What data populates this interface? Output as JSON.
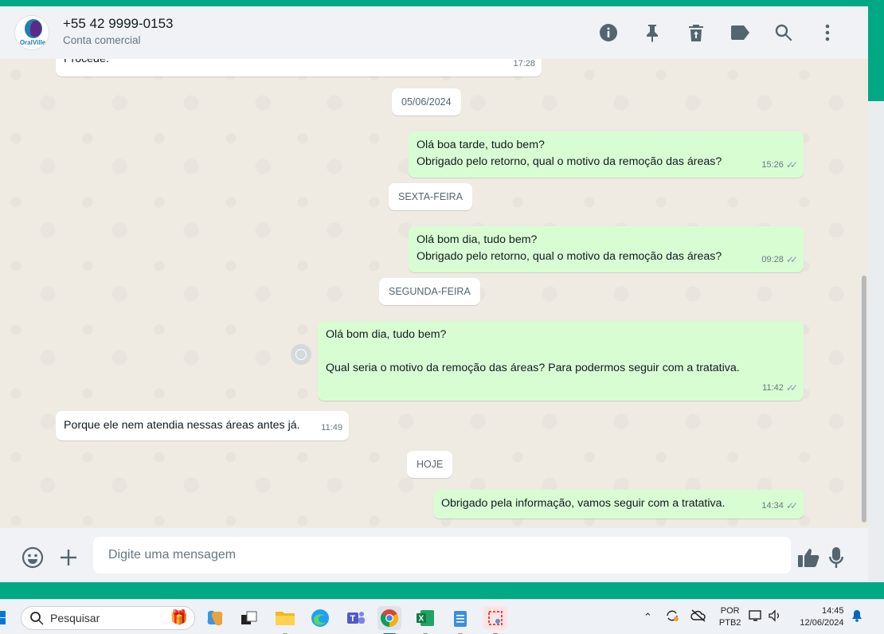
{
  "header": {
    "avatar_brand": "OralVille",
    "contact_name": "+55 42 9999-0153",
    "contact_subtitle": "Conta comercial",
    "icons": [
      "info-icon",
      "pin-icon",
      "delete-icon",
      "label-icon",
      "search-icon",
      "more-icon"
    ]
  },
  "chat": {
    "messages": [
      {
        "type": "in",
        "text": "Procede.",
        "time": "17:28"
      },
      {
        "type": "date",
        "text": "05/06/2024"
      },
      {
        "type": "out",
        "lines": [
          "Olá boa tarde, tudo bem?",
          "Obrigado pelo retorno, qual o motivo da remoção das áreas?"
        ],
        "time": "15:26"
      },
      {
        "type": "date",
        "text": "SEXTA-FEIRA"
      },
      {
        "type": "out",
        "lines": [
          "Olá bom dia, tudo bem?",
          "Obrigado pelo retorno, qual o motivo da remoção das áreas?"
        ],
        "time": "09:28"
      },
      {
        "type": "date",
        "text": "SEGUNDA-FEIRA"
      },
      {
        "type": "out",
        "lines": [
          "Olá bom dia, tudo bem?",
          "",
          "Qual seria o motivo da remoção das áreas? Para podermos seguir com a tratativa."
        ],
        "time": "11:42"
      },
      {
        "type": "in",
        "text": "Porque ele nem atendia nessas áreas antes já.",
        "time": "11:49"
      },
      {
        "type": "date",
        "text": "HOJE"
      },
      {
        "type": "out",
        "text": "Obrigado pela informação, vamos seguir com a tratativa.",
        "time": "14:34"
      }
    ]
  },
  "composer": {
    "placeholder": "Digite uma mensagem"
  },
  "taskbar": {
    "search_label": "Pesquisar",
    "lang_top": "POR",
    "lang_bottom": "PTB2",
    "time": "14:45",
    "date": "12/06/2024",
    "accent": "#0067c0"
  }
}
